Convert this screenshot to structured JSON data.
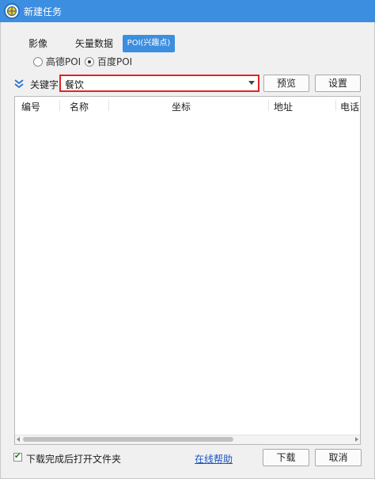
{
  "window": {
    "title": "新建任务"
  },
  "tabs": [
    {
      "label": "影像",
      "active": false
    },
    {
      "label": "矢量数据",
      "active": false
    },
    {
      "label": "POI(兴趣点)",
      "active": true
    }
  ],
  "poi_source": {
    "options": [
      {
        "label": "高德POI",
        "checked": false
      },
      {
        "label": "百度POI",
        "checked": true
      }
    ]
  },
  "keyword": {
    "label": "关键字:",
    "value": "餐饮"
  },
  "buttons": {
    "preview": "预览",
    "settings": "设置",
    "download": "下载",
    "cancel": "取消"
  },
  "table": {
    "columns": [
      "编号",
      "名称",
      "坐标",
      "地址",
      "电话"
    ],
    "rows": []
  },
  "footer": {
    "open_folder_label": "下载完成后打开文件夹",
    "open_folder_checked": true,
    "help_link": "在线帮助"
  },
  "colors": {
    "titlebar": "#3b8ee0",
    "active_tab": "#3b8ee0",
    "highlight_border": "#e02424",
    "link": "#1a56c5"
  }
}
